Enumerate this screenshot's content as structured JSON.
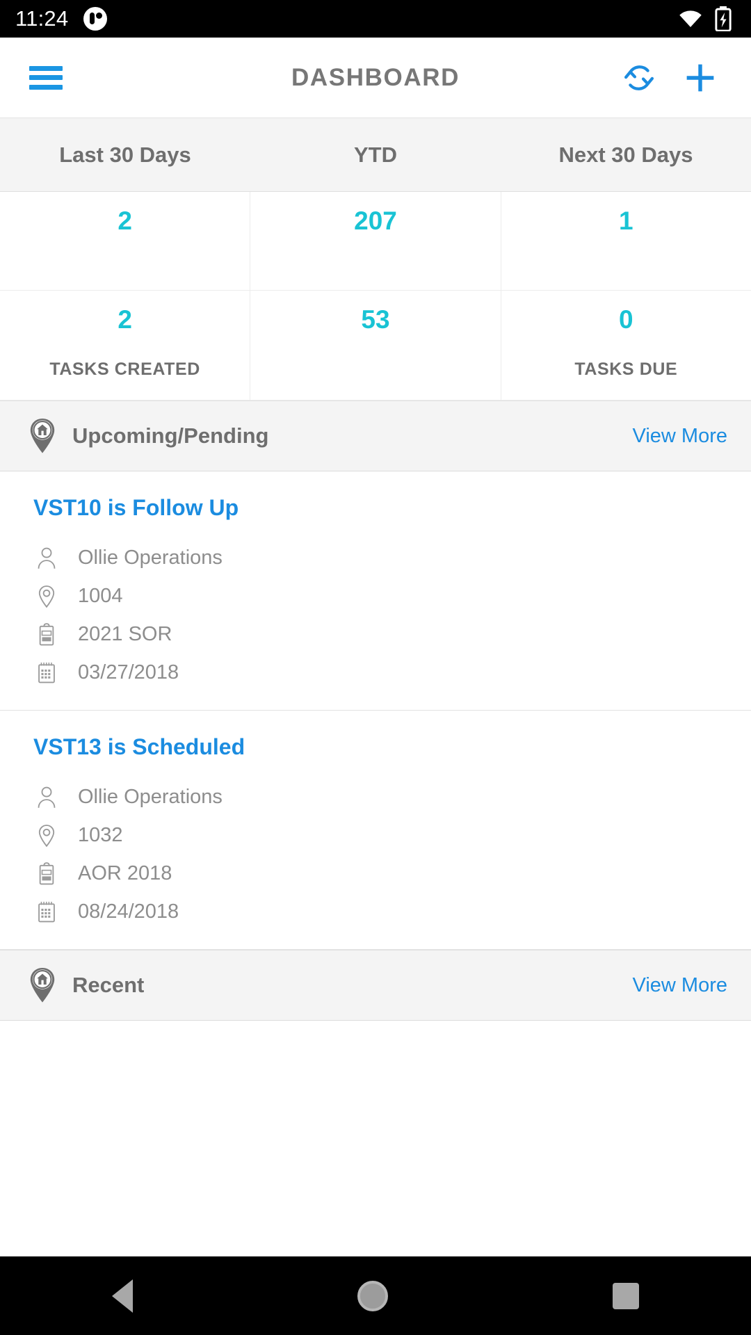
{
  "statusbar": {
    "time": "11:24",
    "notification_icon": "notification-badge-icon",
    "wifi_icon": "wifi-icon",
    "battery_icon": "battery-charging-icon"
  },
  "toolbar": {
    "menu_icon": "hamburger-menu-icon",
    "title": "DASHBOARD",
    "sync_icon": "sync-refresh-icon",
    "add_icon": "plus-add-icon"
  },
  "stats": {
    "columns": [
      "Last 30 Days",
      "YTD",
      "Next 30 Days"
    ],
    "rows": [
      {
        "values": [
          "2",
          "207",
          "1"
        ],
        "labels": [
          "",
          "",
          ""
        ]
      },
      {
        "values": [
          "2",
          "53",
          "0"
        ],
        "labels": [
          "TASKS CREATED",
          "",
          "TASKS DUE"
        ]
      }
    ]
  },
  "sections": [
    {
      "icon": "map-pin-house-icon",
      "title": "Upcoming/Pending",
      "view_more": "View More"
    },
    {
      "icon": "map-pin-house-icon",
      "title": "Recent",
      "view_more": "View More"
    }
  ],
  "upcoming_items": [
    {
      "title": "VST10 is Follow Up",
      "person_icon": "person-icon",
      "person": "Ollie Operations",
      "location_icon": "location-pin-icon",
      "location": "1004",
      "document_icon": "clipboard-icon",
      "document": "2021 SOR",
      "date_icon": "calendar-icon",
      "date": "03/27/2018"
    },
    {
      "title": "VST13 is Scheduled",
      "person_icon": "person-icon",
      "person": "Ollie Operations",
      "location_icon": "location-pin-icon",
      "location": "1032",
      "document_icon": "clipboard-icon",
      "document": "AOR 2018",
      "date_icon": "calendar-icon",
      "date": "08/24/2018"
    }
  ],
  "recent_partial": {
    "title": "",
    "right_text": ""
  },
  "navbar": {
    "back_icon": "back-triangle-icon",
    "home_icon": "home-circle-icon",
    "recents_icon": "recents-square-icon"
  },
  "colors": {
    "accent_blue": "#1b8ce0",
    "teal": "#19c3d4",
    "gray_text": "#6e6e6e",
    "muted_text": "#8d8d8d",
    "band_bg": "#f4f4f4"
  }
}
